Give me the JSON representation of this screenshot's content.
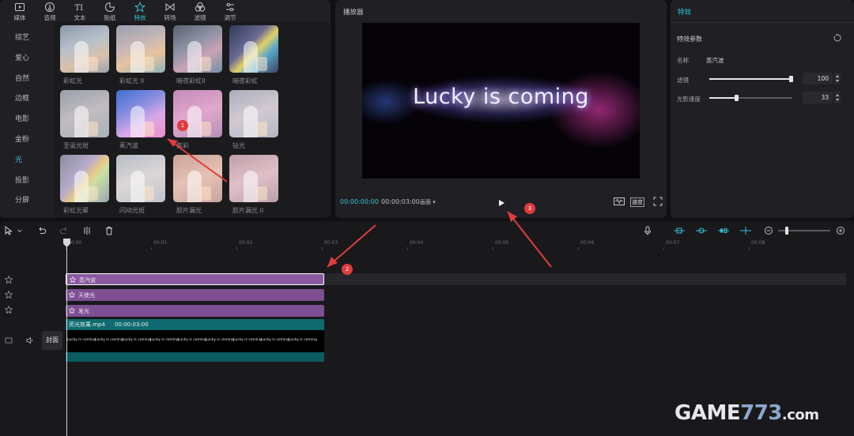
{
  "toolbar": {
    "items": [
      {
        "label": "媒体",
        "icon": "media-icon"
      },
      {
        "label": "音频",
        "icon": "audio-icon"
      },
      {
        "label": "文本",
        "icon": "text-icon"
      },
      {
        "label": "贴纸",
        "icon": "sticker-icon"
      },
      {
        "label": "特效",
        "icon": "effects-icon"
      },
      {
        "label": "转场",
        "icon": "transition-icon"
      },
      {
        "label": "滤镜",
        "icon": "filter-icon"
      },
      {
        "label": "调节",
        "icon": "adjust-icon"
      }
    ],
    "active_index": 4
  },
  "categories": {
    "items": [
      "综艺",
      "爱心",
      "自然",
      "边框",
      "电影",
      "金粉",
      "光",
      "投影",
      "分屏"
    ],
    "active_index": 6
  },
  "effects": {
    "items": [
      "彩虹光",
      "彩虹光 II",
      "暗夜彩虹II",
      "暗夜彩虹",
      "圣诞光斑",
      "蒸汽波",
      "紫彩",
      "钻光",
      "彩虹光晕",
      "闪动光斑",
      "胶片漏光",
      "胶片漏光 II"
    ]
  },
  "player": {
    "title": "播放器",
    "preview_text": "Lucky is coming",
    "current_time": "00:00:00:00",
    "total_time": "00:00:03:00",
    "ratio_label": "画面",
    "speed_label": "速度"
  },
  "inspector": {
    "tab": "特效",
    "section_title": "特效参数",
    "name_label": "名称",
    "name_value": "蒸汽波",
    "filter_label": "滤镜",
    "filter_value": "100",
    "speed_label": "光影速度",
    "speed_value": "33"
  },
  "timeline": {
    "ruler": [
      "00:00",
      "00:01",
      "00:02",
      "00:03",
      "00:04",
      "00:05",
      "00:06",
      "00:07",
      "00:08"
    ],
    "effect_clips": [
      "蒸汽波",
      "天使光",
      "发光"
    ],
    "video_clip": {
      "filename": "荧光效果.mp4",
      "duration": "00:00:03:00",
      "frame_text": "Lucky is coming"
    },
    "cover_label": "封面"
  },
  "annotations": [
    "1",
    "2",
    "3"
  ],
  "watermark": {
    "part1": "GAME",
    "part2": "773",
    "part3": ".com"
  },
  "colors": {
    "accent": "#35c2d6",
    "effect_clip": "#7f4f94",
    "video_clip": "#0b5b60",
    "annotation": "#e03c3c"
  }
}
